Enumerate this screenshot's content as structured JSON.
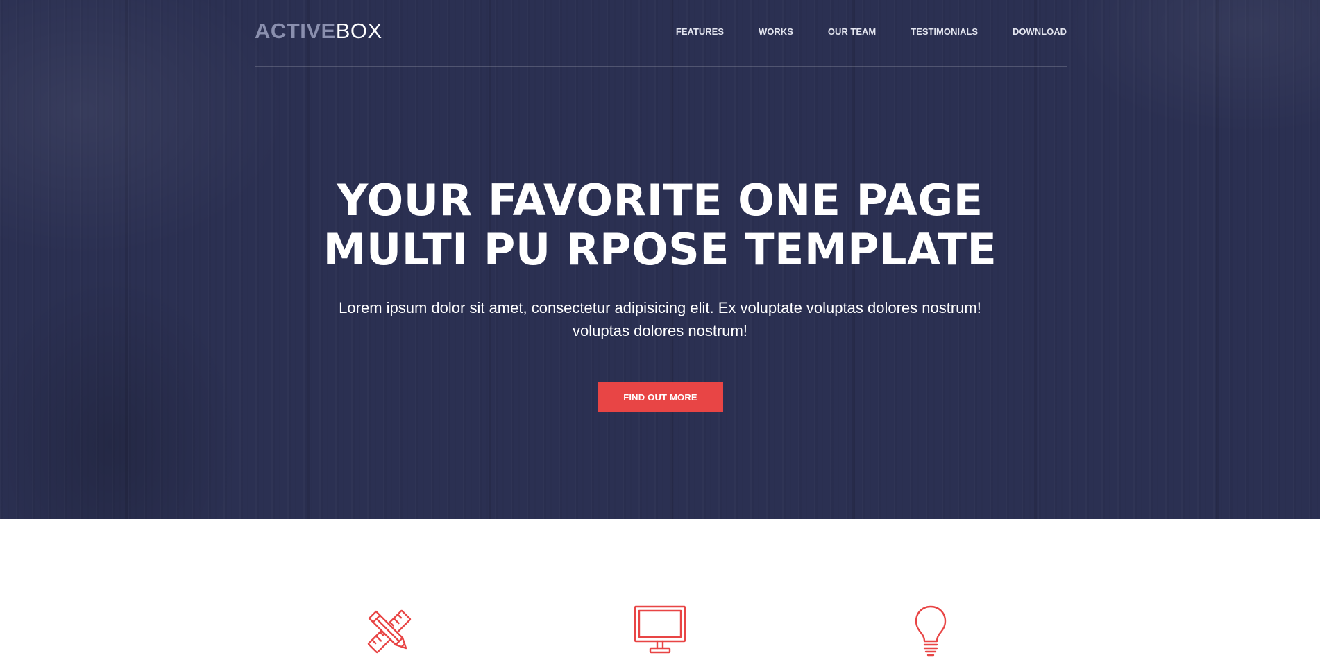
{
  "brand": {
    "logo_part1": "ACTIVE",
    "logo_part2": "BOX"
  },
  "nav": {
    "items": [
      {
        "label": "FEATURES"
      },
      {
        "label": "WORKS"
      },
      {
        "label": "OUR TEAM"
      },
      {
        "label": "TESTIMONIALS"
      },
      {
        "label": "DOWNLOAD"
      }
    ]
  },
  "hero": {
    "headline_line1": "YOUR FAVORITE ONE PAGE",
    "headline_line2": "MULTI PU RPOSE TEMPLATE",
    "subtitle_line1": "Lorem ipsum dolor sit amet, consectetur adipisicing elit. Ex voluptate voluptas dolores nostrum!",
    "subtitle_line2": "voluptas dolores nostrum!",
    "cta_label": "FIND OUT MORE"
  },
  "features": {
    "icons": [
      "pencil-ruler-icon",
      "monitor-icon",
      "lightbulb-icon"
    ]
  },
  "colors": {
    "hero_background": "#2b3052",
    "accent": "#e84545",
    "logo_muted": "#8a8fae",
    "text_light": "#ffffff"
  }
}
